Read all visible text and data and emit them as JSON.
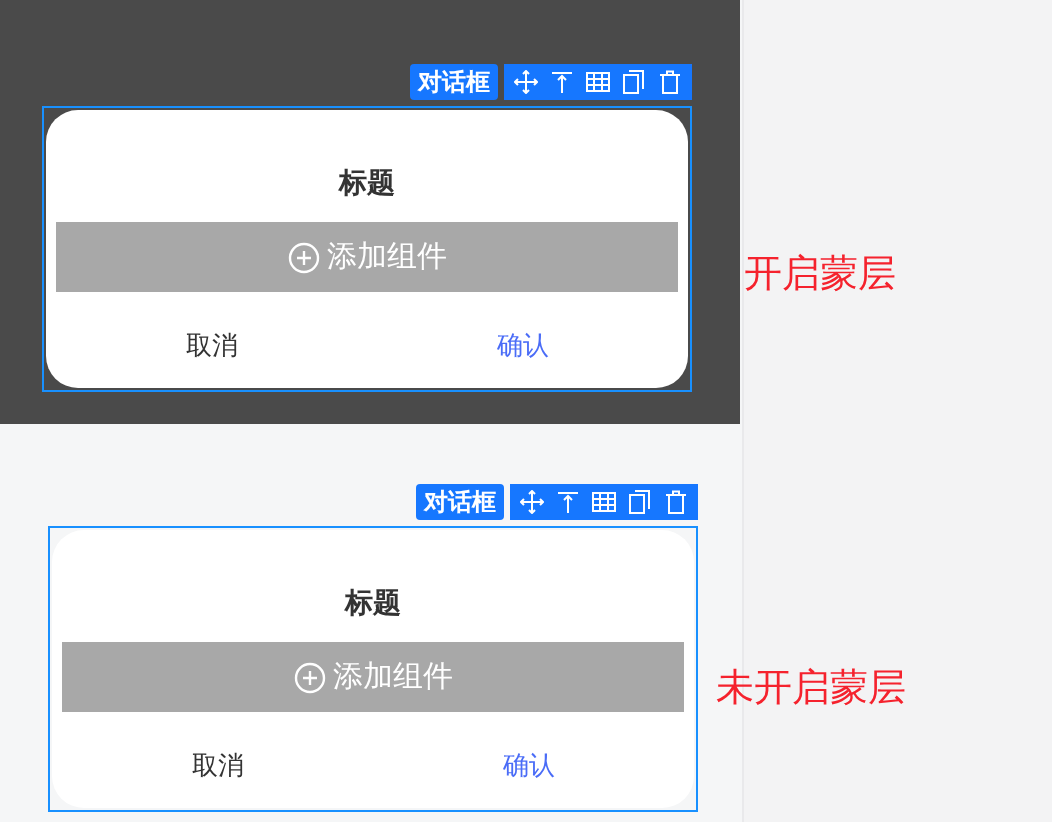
{
  "sections": [
    {
      "mask": true,
      "tag": "对话框",
      "dialog": {
        "title": "标题",
        "add_button": "添加组件",
        "cancel": "取消",
        "confirm": "确认"
      },
      "caption": "开启蒙层"
    },
    {
      "mask": false,
      "tag": "对话框",
      "dialog": {
        "title": "标题",
        "add_button": "添加组件",
        "cancel": "取消",
        "confirm": "确认"
      },
      "caption": "未开启蒙层"
    }
  ]
}
